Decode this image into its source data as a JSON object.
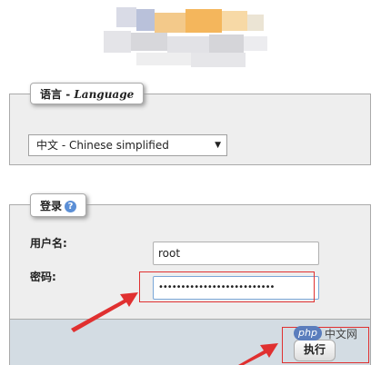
{
  "language_panel": {
    "legend_cn": "语言",
    "legend_sep": " - ",
    "legend_en": "Language",
    "selected_language": "中文 - Chinese simplified"
  },
  "login_panel": {
    "legend": "登录",
    "username_label": "用户名:",
    "username_value": "root",
    "password_label": "密码:",
    "password_mask": "••••••••••••••••••••••••••",
    "submit_label": "执行"
  },
  "watermark": {
    "brand": "php",
    "text": "中文网"
  },
  "colors": {
    "annotation_red": "#e03030",
    "footer_bg": "#d3dce3",
    "panel_bg": "#eeeeee"
  }
}
